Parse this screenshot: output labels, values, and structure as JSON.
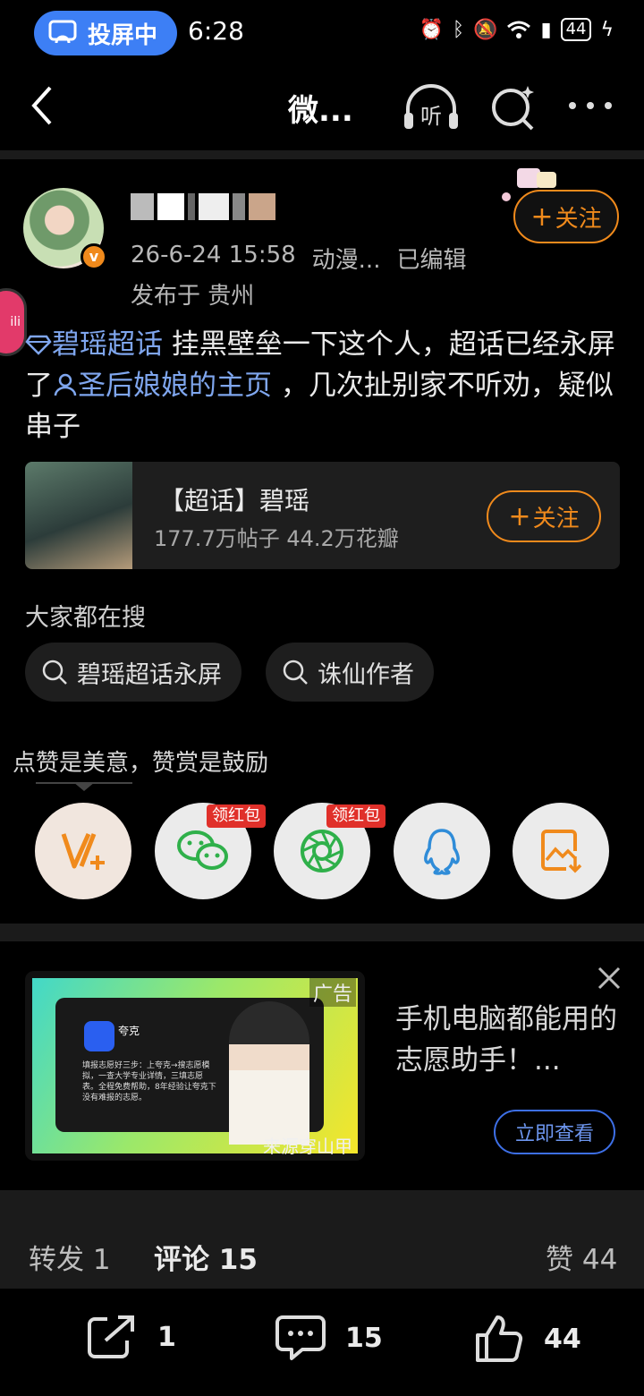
{
  "status_bar": {
    "cast_label": "投屏中",
    "time": "6:28",
    "battery": "44"
  },
  "nav": {
    "title": "微...",
    "listen_label": "听"
  },
  "post": {
    "meta_time": "26-6-24 15:58",
    "meta_source": "动漫...",
    "meta_edited": "已编辑",
    "location": "发布于 贵州",
    "follow_label": "关注",
    "side_tab": "ili",
    "body": {
      "topic_link": "碧瑶超话",
      "text1": " 挂黑壁垒一下这个人，超话已经永屏了",
      "user_link": "圣后娘娘的主页",
      "text2": " ，几次扯别家不听劝，疑似串子"
    }
  },
  "topic_card": {
    "title": "【超话】碧瑶",
    "stats": "177.7万帖子 44.2万花瓣",
    "follow_label": "关注"
  },
  "search": {
    "title": "大家都在搜",
    "chips": [
      "碧瑶超话永屏",
      "诛仙作者"
    ]
  },
  "share": {
    "hint": "点赞是美意，赞赏是鼓励",
    "tag_label": "领红包",
    "buttons": [
      {
        "icon": "reward-v-plus-icon"
      },
      {
        "icon": "wechat-icon"
      },
      {
        "icon": "moments-icon"
      },
      {
        "icon": "qq-icon"
      },
      {
        "icon": "save-image-icon"
      }
    ]
  },
  "ad": {
    "badge": "广告",
    "source": "来源穿山甲",
    "app_name": "夸克",
    "fine_print": "填报志愿好三步：上夸克→搜志愿模拟，一查大学专业详情，三填志愿表。全程免费帮助，8年经验让夸克下没有难报的志愿。",
    "text": "手机电脑都能用的志愿助手！...",
    "cta": "立即查看"
  },
  "tabs": {
    "repost": "转发 1",
    "comment": "评论 15",
    "like": "赞 44"
  },
  "actions": {
    "repost_count": "1",
    "comment_count": "15",
    "like_count": "44"
  },
  "colors": {
    "accent_orange": "#f08a1c",
    "link_blue": "#7fa6ee",
    "cast_blue": "#3d7ff5",
    "red_tag": "#e0302a"
  }
}
